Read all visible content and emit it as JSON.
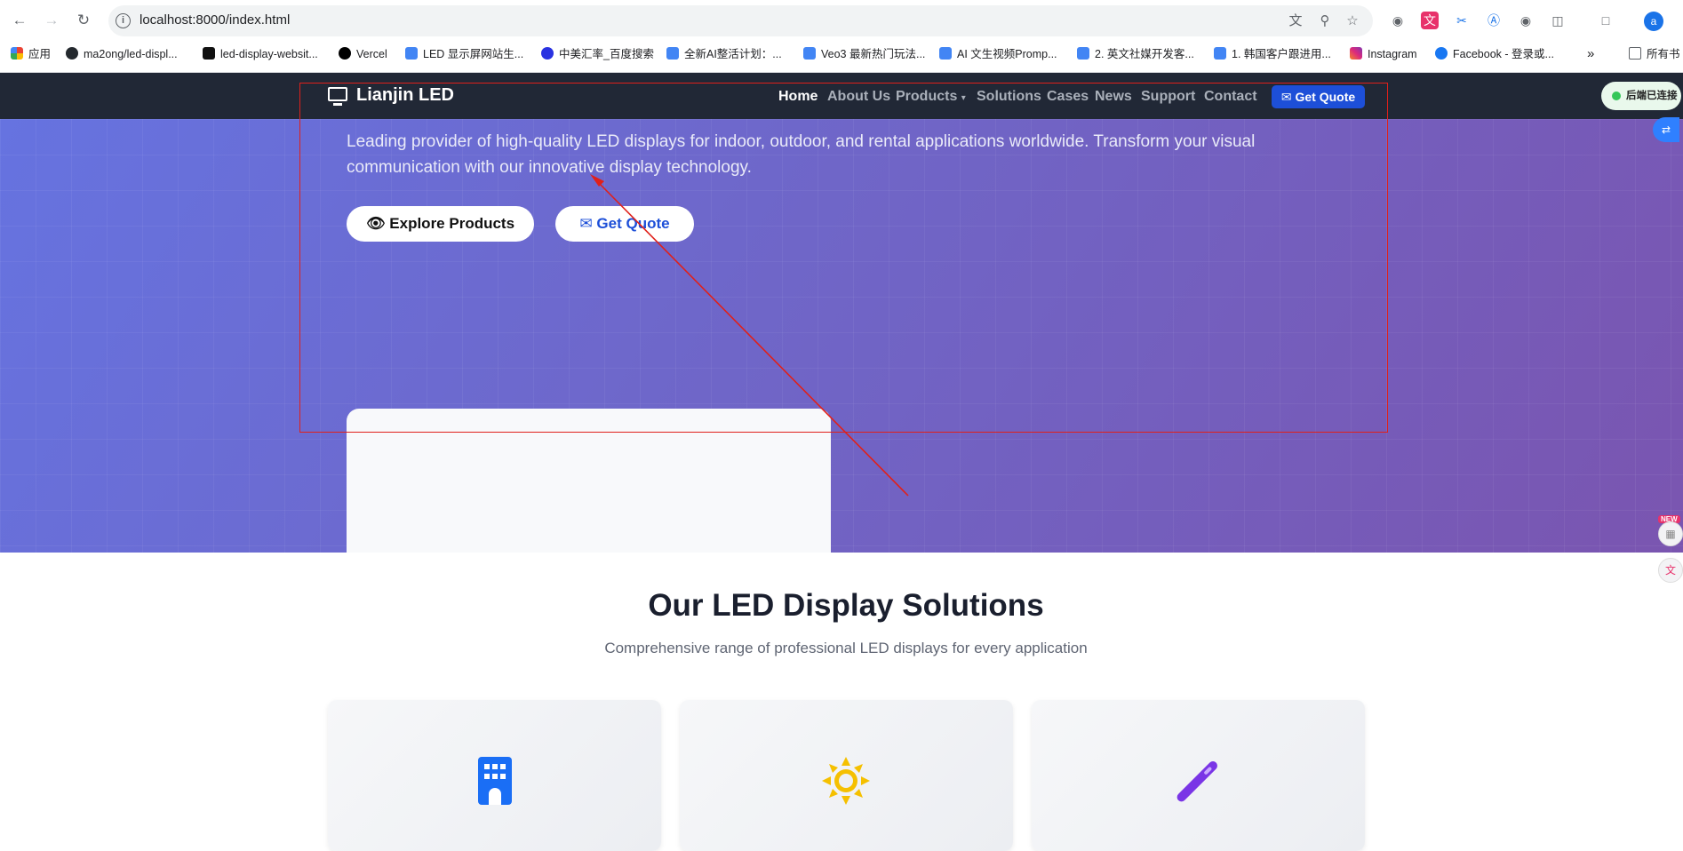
{
  "browser": {
    "url": "localhost:8000/index.html",
    "profile_initial": "a",
    "bookmarks": [
      {
        "label": "应用",
        "icon": "apps-grid-icon"
      },
      {
        "label": "ma2ong/led-displ...",
        "icon": "github-icon"
      },
      {
        "label": "led-display-websit...",
        "icon": "site-icon"
      },
      {
        "label": "Vercel",
        "icon": "vercel-icon"
      },
      {
        "label": "LED 显示屏网站生...",
        "icon": "doc-icon"
      },
      {
        "label": "中美汇率_百度搜索",
        "icon": "baidu-icon"
      },
      {
        "label": "全新AI整活计划：...",
        "icon": "doc-icon"
      },
      {
        "label": "Veo3 最新热门玩法...",
        "icon": "doc-icon"
      },
      {
        "label": "AI 文生视频Promp...",
        "icon": "doc-icon"
      },
      {
        "label": "2. 英文社媒开发客...",
        "icon": "doc-icon"
      },
      {
        "label": "1. 韩国客户跟进用...",
        "icon": "doc-icon"
      },
      {
        "label": "Instagram",
        "icon": "instagram-icon"
      },
      {
        "label": "Facebook - 登录或...",
        "icon": "facebook-icon"
      }
    ],
    "more_bookmarks": "»",
    "all_bookmarks_label": "所有书"
  },
  "site": {
    "brand": "Lianjin LED",
    "nav": [
      {
        "label": "Home",
        "active": true
      },
      {
        "label": "About Us",
        "active": false
      },
      {
        "label": "Products",
        "active": false
      },
      {
        "label": "Solutions",
        "active": false
      },
      {
        "label": "Cases",
        "active": false
      },
      {
        "label": "News",
        "active": false
      },
      {
        "label": "Support",
        "active": false
      },
      {
        "label": "Contact",
        "active": false
      }
    ],
    "quote_button": "Get Quote",
    "status_pill": "后端已连接"
  },
  "hero": {
    "text": "Leading provider of high-quality LED displays for indoor, outdoor, and rental applications worldwide. Transform your visual communication with our innovative display technology.",
    "explore_button": "Explore Products",
    "quote_button": "Get Quote"
  },
  "solutions": {
    "title": "Our LED Display Solutions",
    "subtitle": "Comprehensive range of professional LED displays for every application",
    "cards": [
      {
        "icon": "building-icon",
        "color": "#1a6ef5"
      },
      {
        "icon": "sun-icon",
        "color": "#f5c000"
      },
      {
        "icon": "wand-icon",
        "color": "#7a35e6"
      }
    ]
  },
  "side_badge": "NEW",
  "annotation_color": "#e0201a"
}
